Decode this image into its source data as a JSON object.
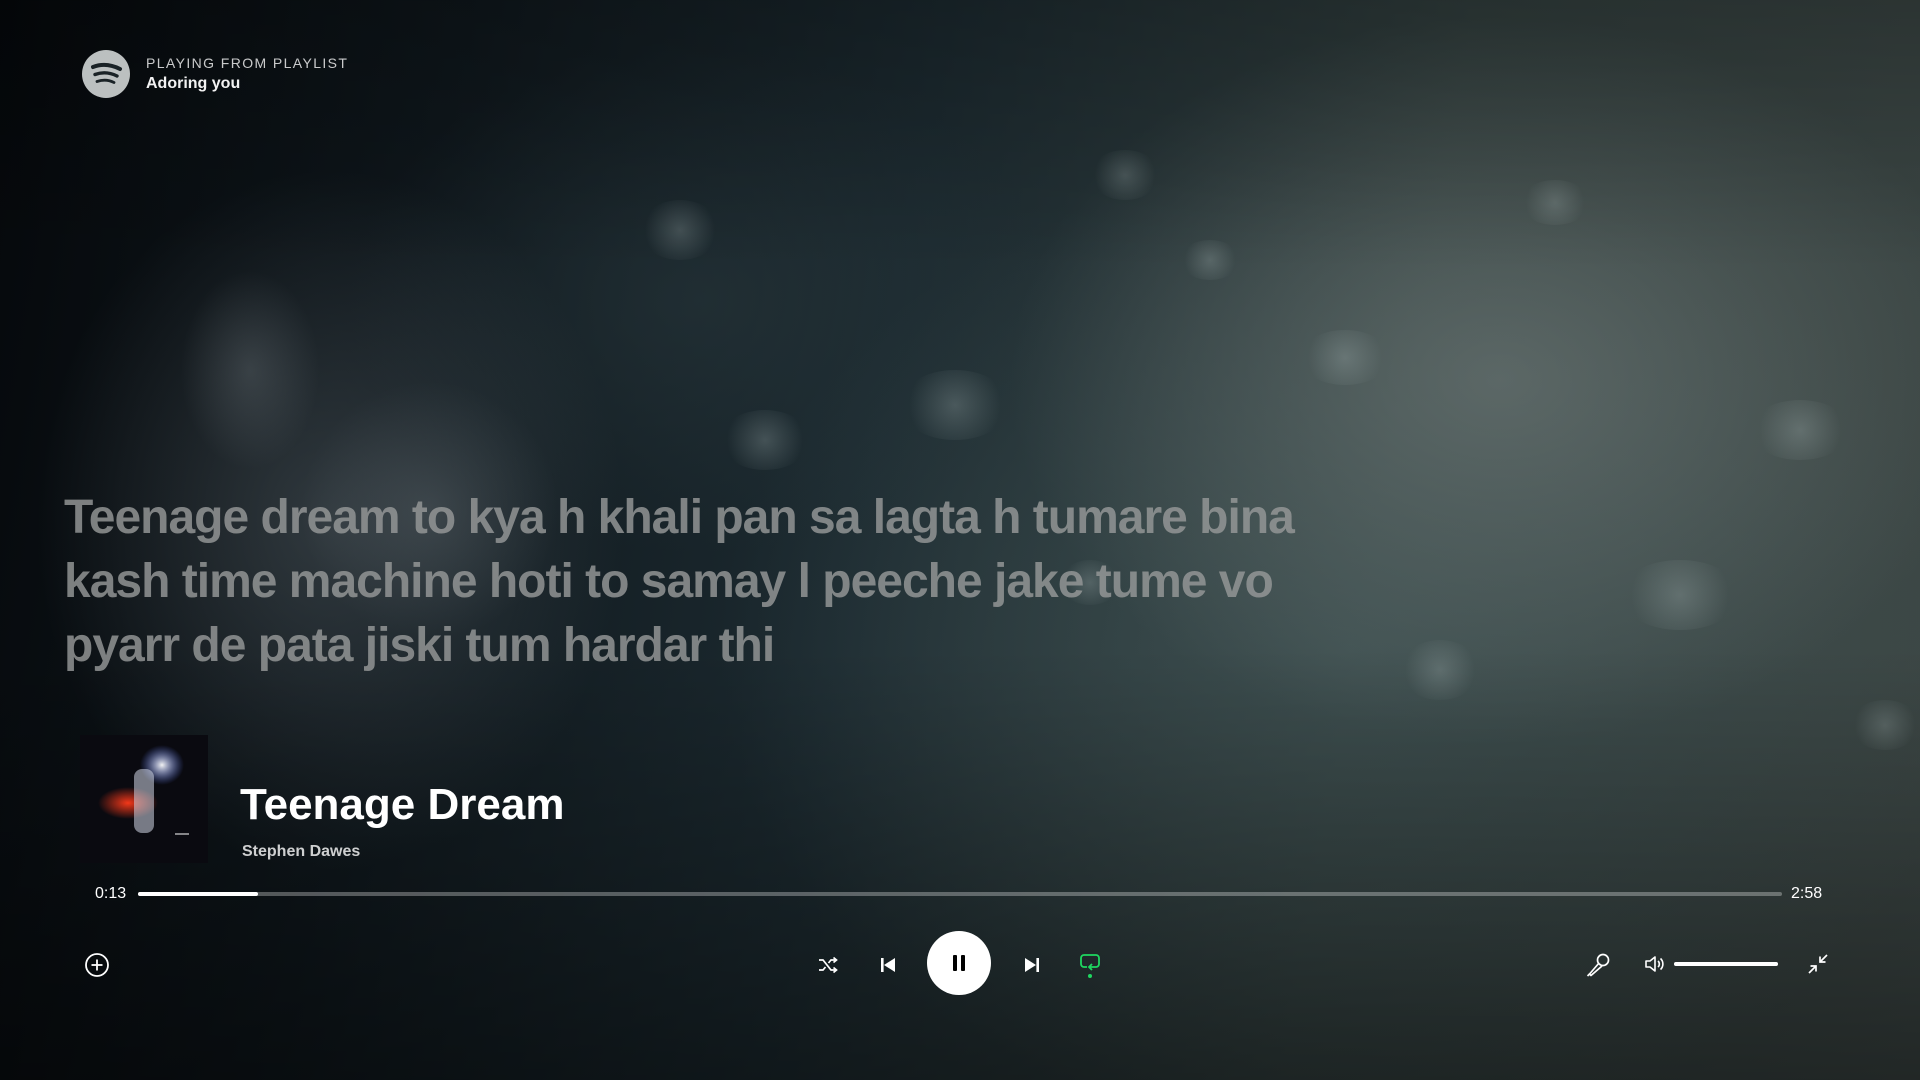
{
  "header": {
    "context_label": "PLAYING FROM PLAYLIST",
    "context_name": "Adoring you"
  },
  "lyrics": {
    "lines": [
      "Teenage dream to kya h khali pan sa lagta h tumare bina",
      "kash time machine hoti to samay l peeche jake tume vo",
      "pyarr de pata jiski tum hardar thi"
    ]
  },
  "now_playing": {
    "title": "Teenage Dream",
    "artist": "Stephen Dawes"
  },
  "progress": {
    "elapsed": "0:13",
    "total": "2:58",
    "fraction": 0.073
  },
  "volume": {
    "level": 1.0
  },
  "controls": {
    "repeat_active": true,
    "accent_color": "#1ed760",
    "icons": [
      "add-circle-icon",
      "shuffle-icon",
      "previous-icon",
      "pause-icon",
      "next-icon",
      "repeat-icon",
      "microphone-icon",
      "volume-icon",
      "minimize-icon"
    ]
  }
}
